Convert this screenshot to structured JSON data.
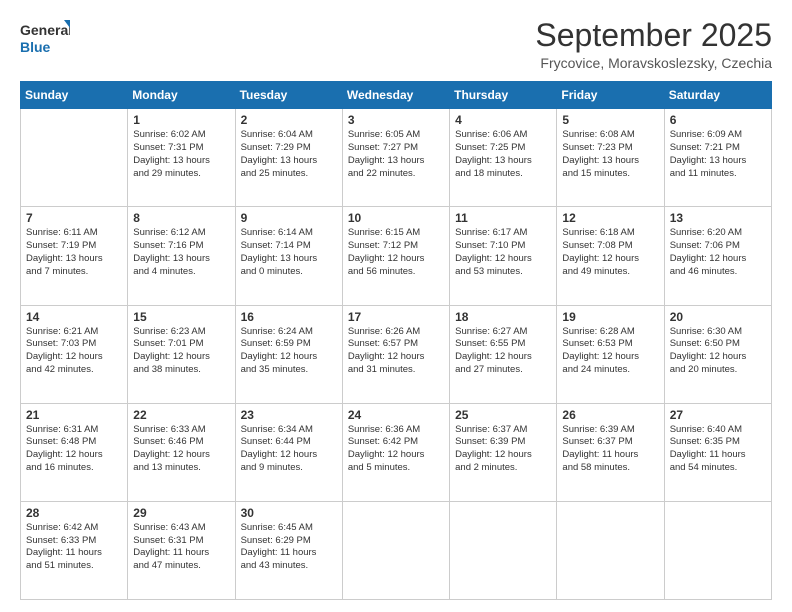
{
  "logo": {
    "line1": "General",
    "line2": "Blue"
  },
  "title": "September 2025",
  "location": "Frycovice, Moravskoslezsky, Czechia",
  "days_header": [
    "Sunday",
    "Monday",
    "Tuesday",
    "Wednesday",
    "Thursday",
    "Friday",
    "Saturday"
  ],
  "weeks": [
    [
      {
        "day": "",
        "info": ""
      },
      {
        "day": "1",
        "info": "Sunrise: 6:02 AM\nSunset: 7:31 PM\nDaylight: 13 hours\nand 29 minutes."
      },
      {
        "day": "2",
        "info": "Sunrise: 6:04 AM\nSunset: 7:29 PM\nDaylight: 13 hours\nand 25 minutes."
      },
      {
        "day": "3",
        "info": "Sunrise: 6:05 AM\nSunset: 7:27 PM\nDaylight: 13 hours\nand 22 minutes."
      },
      {
        "day": "4",
        "info": "Sunrise: 6:06 AM\nSunset: 7:25 PM\nDaylight: 13 hours\nand 18 minutes."
      },
      {
        "day": "5",
        "info": "Sunrise: 6:08 AM\nSunset: 7:23 PM\nDaylight: 13 hours\nand 15 minutes."
      },
      {
        "day": "6",
        "info": "Sunrise: 6:09 AM\nSunset: 7:21 PM\nDaylight: 13 hours\nand 11 minutes."
      }
    ],
    [
      {
        "day": "7",
        "info": "Sunrise: 6:11 AM\nSunset: 7:19 PM\nDaylight: 13 hours\nand 7 minutes."
      },
      {
        "day": "8",
        "info": "Sunrise: 6:12 AM\nSunset: 7:16 PM\nDaylight: 13 hours\nand 4 minutes."
      },
      {
        "day": "9",
        "info": "Sunrise: 6:14 AM\nSunset: 7:14 PM\nDaylight: 13 hours\nand 0 minutes."
      },
      {
        "day": "10",
        "info": "Sunrise: 6:15 AM\nSunset: 7:12 PM\nDaylight: 12 hours\nand 56 minutes."
      },
      {
        "day": "11",
        "info": "Sunrise: 6:17 AM\nSunset: 7:10 PM\nDaylight: 12 hours\nand 53 minutes."
      },
      {
        "day": "12",
        "info": "Sunrise: 6:18 AM\nSunset: 7:08 PM\nDaylight: 12 hours\nand 49 minutes."
      },
      {
        "day": "13",
        "info": "Sunrise: 6:20 AM\nSunset: 7:06 PM\nDaylight: 12 hours\nand 46 minutes."
      }
    ],
    [
      {
        "day": "14",
        "info": "Sunrise: 6:21 AM\nSunset: 7:03 PM\nDaylight: 12 hours\nand 42 minutes."
      },
      {
        "day": "15",
        "info": "Sunrise: 6:23 AM\nSunset: 7:01 PM\nDaylight: 12 hours\nand 38 minutes."
      },
      {
        "day": "16",
        "info": "Sunrise: 6:24 AM\nSunset: 6:59 PM\nDaylight: 12 hours\nand 35 minutes."
      },
      {
        "day": "17",
        "info": "Sunrise: 6:26 AM\nSunset: 6:57 PM\nDaylight: 12 hours\nand 31 minutes."
      },
      {
        "day": "18",
        "info": "Sunrise: 6:27 AM\nSunset: 6:55 PM\nDaylight: 12 hours\nand 27 minutes."
      },
      {
        "day": "19",
        "info": "Sunrise: 6:28 AM\nSunset: 6:53 PM\nDaylight: 12 hours\nand 24 minutes."
      },
      {
        "day": "20",
        "info": "Sunrise: 6:30 AM\nSunset: 6:50 PM\nDaylight: 12 hours\nand 20 minutes."
      }
    ],
    [
      {
        "day": "21",
        "info": "Sunrise: 6:31 AM\nSunset: 6:48 PM\nDaylight: 12 hours\nand 16 minutes."
      },
      {
        "day": "22",
        "info": "Sunrise: 6:33 AM\nSunset: 6:46 PM\nDaylight: 12 hours\nand 13 minutes."
      },
      {
        "day": "23",
        "info": "Sunrise: 6:34 AM\nSunset: 6:44 PM\nDaylight: 12 hours\nand 9 minutes."
      },
      {
        "day": "24",
        "info": "Sunrise: 6:36 AM\nSunset: 6:42 PM\nDaylight: 12 hours\nand 5 minutes."
      },
      {
        "day": "25",
        "info": "Sunrise: 6:37 AM\nSunset: 6:39 PM\nDaylight: 12 hours\nand 2 minutes."
      },
      {
        "day": "26",
        "info": "Sunrise: 6:39 AM\nSunset: 6:37 PM\nDaylight: 11 hours\nand 58 minutes."
      },
      {
        "day": "27",
        "info": "Sunrise: 6:40 AM\nSunset: 6:35 PM\nDaylight: 11 hours\nand 54 minutes."
      }
    ],
    [
      {
        "day": "28",
        "info": "Sunrise: 6:42 AM\nSunset: 6:33 PM\nDaylight: 11 hours\nand 51 minutes."
      },
      {
        "day": "29",
        "info": "Sunrise: 6:43 AM\nSunset: 6:31 PM\nDaylight: 11 hours\nand 47 minutes."
      },
      {
        "day": "30",
        "info": "Sunrise: 6:45 AM\nSunset: 6:29 PM\nDaylight: 11 hours\nand 43 minutes."
      },
      {
        "day": "",
        "info": ""
      },
      {
        "day": "",
        "info": ""
      },
      {
        "day": "",
        "info": ""
      },
      {
        "day": "",
        "info": ""
      }
    ]
  ]
}
